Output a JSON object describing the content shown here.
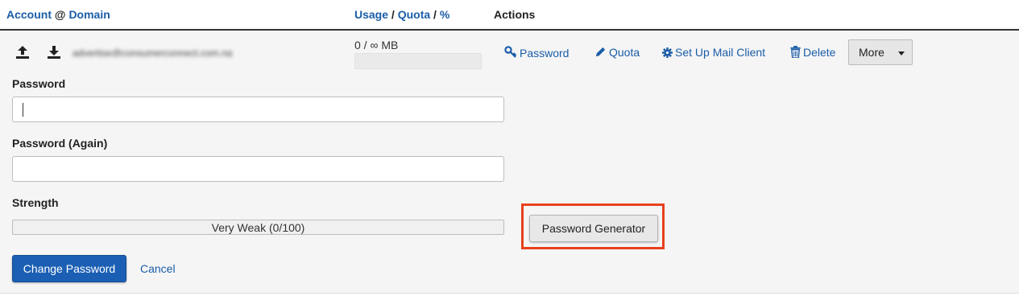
{
  "header": {
    "account_label": "Account",
    "at_sign": "@",
    "domain_label": "Domain",
    "usage_label": "Usage",
    "slash1": "/",
    "quota_label": "Quota",
    "slash2": "/",
    "percent_label": "%",
    "actions_label": "Actions"
  },
  "row": {
    "email_obscured": "advertise@consumerconnect.com.ng",
    "icons": [
      "upload-icon",
      "download-icon"
    ],
    "usage_text": "0 / ∞ MB",
    "usage_fraction": 0,
    "actions": {
      "password": "Password",
      "quota": "Quota",
      "setup": "Set Up Mail Client",
      "delete": "Delete",
      "more": "More"
    },
    "action_icons": [
      "key-icon",
      "pencil-icon",
      "gear-icon",
      "trash-icon",
      "caret-down-icon"
    ]
  },
  "form": {
    "password_label": "Password",
    "password_value": "",
    "password_again_label": "Password (Again)",
    "password_again_value": "",
    "strength_label": "Strength",
    "strength_text": "Very Weak (0/100)",
    "strength_score": 0,
    "generator_button": "Password Generator",
    "change_button": "Change Password",
    "cancel_link": "Cancel"
  },
  "colors": {
    "link": "#1a5da8",
    "primary": "#1b5fb4",
    "highlight": "#e8401c",
    "row_bg": "#f5f5f5"
  }
}
